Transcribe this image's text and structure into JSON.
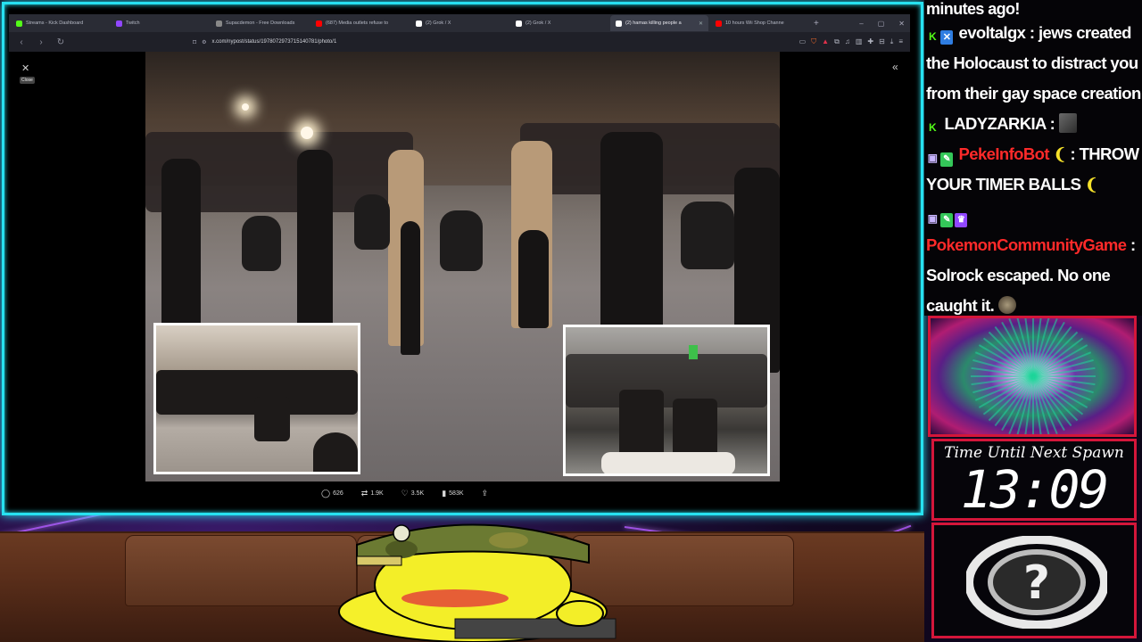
{
  "browser": {
    "tabs": [
      {
        "label": "Streams - Kick Dashboard",
        "favicon_color": "#53fc18"
      },
      {
        "label": "Twitch",
        "favicon_color": "#9147ff"
      },
      {
        "label": "Supacdemon - Free Downloads",
        "favicon_color": "#888888"
      },
      {
        "label": "(687) Media outlets refuse to",
        "favicon_color": "#ff0000"
      },
      {
        "label": "(2) Grok / X",
        "favicon_color": "#ffffff"
      },
      {
        "label": "(2) Grok / X",
        "favicon_color": "#ffffff"
      },
      {
        "label": "(2) hamas killing people a",
        "favicon_color": "#ffffff",
        "active": true
      },
      {
        "label": "10 hours Wii Shop Channe",
        "favicon_color": "#ff0000"
      }
    ],
    "new_tab_icon": "+",
    "url": "x.com/nypost/status/1978072973715140781/photo/1",
    "close_tooltip": "Close"
  },
  "post_actions": {
    "replies": "626",
    "reposts": "1.9K",
    "likes": "3.5K",
    "views": "583K"
  },
  "chat": {
    "partial_top": "minutes ago!",
    "messages": [
      {
        "user": "evoltalgx",
        "user_color": "#ffffff",
        "text": ": jews created the Holocaust to distract you from their gay space creation"
      },
      {
        "user": "LADYZARKIA",
        "user_color": "#ffffff",
        "text": ":"
      },
      {
        "user": "PekeInfoBot",
        "user_color": "#ff2a2a",
        "text": ": THROW YOUR TIMER BALLS"
      },
      {
        "user": "PokemonCommunityGame",
        "user_color": "#ff2a2a",
        "text": ": Solrock escaped. No one caught it."
      }
    ]
  },
  "timer": {
    "label": "Time Until Next Spawn",
    "value": "13:09"
  },
  "colors": {
    "frame_accent": "#27e1f0",
    "widget_border": "#d4163a",
    "kick_green": "#53fc18"
  }
}
